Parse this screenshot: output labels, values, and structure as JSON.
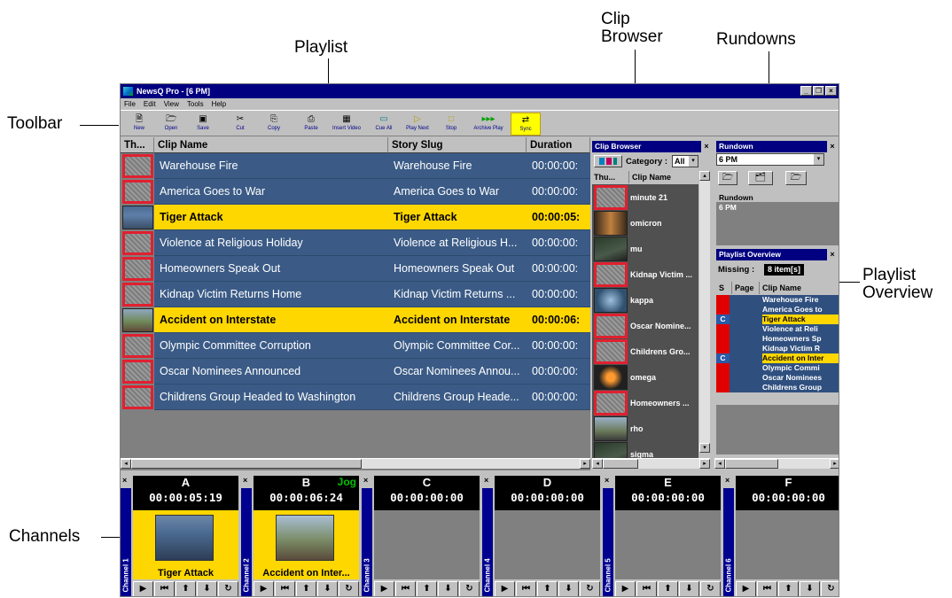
{
  "annotations": {
    "playlist": "Playlist",
    "clip_browser_l1": "Clip",
    "clip_browser_l2": "Browser",
    "rundowns": "Rundowns",
    "toolbar": "Toolbar",
    "playlist_overview_l1": "Playlist",
    "playlist_overview_l2": "Overview",
    "channels": "Channels"
  },
  "window": {
    "title": "NewsQ Pro - [6 PM]",
    "minimize": "_",
    "restore": "❐",
    "close": "×"
  },
  "menu": [
    "File",
    "Edit",
    "View",
    "Tools",
    "Help"
  ],
  "toolbar": [
    {
      "label": "New",
      "icon": "new-icon",
      "glyph": "🗎"
    },
    {
      "label": "Open",
      "icon": "open-icon",
      "glyph": "🗁"
    },
    {
      "label": "Save",
      "icon": "save-icon",
      "glyph": "▣"
    },
    {
      "label": "Cut",
      "icon": "cut-icon",
      "glyph": "✂"
    },
    {
      "label": "Copy",
      "icon": "copy-icon",
      "glyph": "⎘"
    },
    {
      "label": "Paste",
      "icon": "paste-icon",
      "glyph": "⎙"
    },
    {
      "label": "Insert Video",
      "icon": "insert-video-icon",
      "glyph": "▦"
    },
    {
      "label": "Cue All",
      "icon": "cue-all-icon",
      "glyph": "▭"
    },
    {
      "label": "Play Next",
      "icon": "play-next-icon",
      "glyph": "▷"
    },
    {
      "label": "Stop",
      "icon": "stop-icon",
      "glyph": "□"
    },
    {
      "label": "Archive Play",
      "icon": "archive-play-icon",
      "glyph": "▸▸▸"
    },
    {
      "label": "Sync",
      "icon": "sync-icon",
      "glyph": "⇄"
    }
  ],
  "playlist": {
    "columns": [
      "Th...",
      "Clip Name",
      "Story Slug",
      "Duration"
    ],
    "rows": [
      {
        "clip": "Warehouse Fire",
        "slug": "Warehouse Fire",
        "duration": "00:00:00:",
        "thumb": "gray",
        "selected": false
      },
      {
        "clip": "America Goes to War",
        "slug": "America Goes to War",
        "duration": "00:00:00:",
        "thumb": "gray",
        "selected": false
      },
      {
        "clip": "Tiger Attack",
        "slug": "Tiger Attack",
        "duration": "00:00:05:",
        "thumb": "photo1",
        "selected": true
      },
      {
        "clip": "Violence at Religious Holiday",
        "slug": "Violence at Religious H...",
        "duration": "00:00:00:",
        "thumb": "gray",
        "selected": false
      },
      {
        "clip": "Homeowners Speak Out",
        "slug": "Homeowners Speak Out",
        "duration": "00:00:00:",
        "thumb": "gray",
        "selected": false
      },
      {
        "clip": "Kidnap Victim Returns Home",
        "slug": "Kidnap Victim Returns ...",
        "duration": "00:00:00:",
        "thumb": "gray",
        "selected": false
      },
      {
        "clip": "Accident on Interstate",
        "slug": "Accident on Interstate",
        "duration": "00:00:06:",
        "thumb": "photo2",
        "selected": true
      },
      {
        "clip": "Olympic Committee Corruption",
        "slug": "Olympic Committee Cor...",
        "duration": "00:00:00:",
        "thumb": "gray",
        "selected": false
      },
      {
        "clip": "Oscar Nominees Announced",
        "slug": "Oscar Nominees Annou...",
        "duration": "00:00:00:",
        "thumb": "gray",
        "selected": false
      },
      {
        "clip": "Childrens Group Headed to Washington",
        "slug": "Childrens Group Heade...",
        "duration": "00:00:00:",
        "thumb": "gray",
        "selected": false
      }
    ]
  },
  "clip_browser": {
    "title": "Clip Browser",
    "category_label": "Category :",
    "category_value": "All",
    "columns": [
      "Thu...",
      "Clip Name"
    ],
    "items": [
      {
        "name": "minute 21",
        "thumb": "gray"
      },
      {
        "name": "omicron",
        "thumb": "ph-a"
      },
      {
        "name": "mu",
        "thumb": "ph-b"
      },
      {
        "name": "Kidnap Victim ...",
        "thumb": "gray"
      },
      {
        "name": "kappa",
        "thumb": "ph-c"
      },
      {
        "name": "Oscar Nomine...",
        "thumb": "gray"
      },
      {
        "name": "Childrens Gro...",
        "thumb": "gray"
      },
      {
        "name": "omega",
        "thumb": "ph-d"
      },
      {
        "name": "Homeowners ...",
        "thumb": "gray"
      },
      {
        "name": "rho",
        "thumb": "ph-e"
      },
      {
        "name": "sigma",
        "thumb": "ph-b"
      }
    ]
  },
  "rundown": {
    "title": "Rundown",
    "select_value": "6 PM",
    "column": "Rundown",
    "items": [
      "6 PM"
    ]
  },
  "overview": {
    "title": "Playlist Overview",
    "missing_label": "Missing :",
    "missing_value": "8 item[s]",
    "columns": [
      "S",
      "Page",
      "Clip Name"
    ],
    "rows": [
      {
        "s": "",
        "name": "Warehouse Fire",
        "sel": false
      },
      {
        "s": "",
        "name": "America Goes to",
        "sel": false
      },
      {
        "s": "C",
        "name": "Tiger Attack",
        "sel": true
      },
      {
        "s": "",
        "name": "Violence at Reli",
        "sel": false
      },
      {
        "s": "",
        "name": "Homeowners Sp",
        "sel": false
      },
      {
        "s": "",
        "name": "Kidnap Victim R",
        "sel": false
      },
      {
        "s": "C",
        "name": "Accident on Inter",
        "sel": true
      },
      {
        "s": "",
        "name": "Olympic Commi",
        "sel": false
      },
      {
        "s": "",
        "name": "Oscar Nominees",
        "sel": false
      },
      {
        "s": "",
        "name": "Childrens Group",
        "sel": false
      }
    ]
  },
  "channels": [
    {
      "letter": "A",
      "timecode": "00:00:05:19",
      "label": "Channel 1",
      "clip": "Tiger Attack",
      "live": true,
      "jog": ""
    },
    {
      "letter": "B",
      "timecode": "00:00:06:24",
      "label": "Channel 2",
      "clip": "Accident on Inter...",
      "live": true,
      "jog": "Jog"
    },
    {
      "letter": "C",
      "timecode": "00:00:00:00",
      "label": "Channel 3",
      "clip": "",
      "live": false,
      "jog": ""
    },
    {
      "letter": "D",
      "timecode": "00:00:00:00",
      "label": "Channel 4",
      "clip": "",
      "live": false,
      "jog": ""
    },
    {
      "letter": "E",
      "timecode": "00:00:00:00",
      "label": "Channel 5",
      "clip": "",
      "live": false,
      "jog": ""
    },
    {
      "letter": "F",
      "timecode": "00:00:00:00",
      "label": "Channel 6",
      "clip": "",
      "live": false,
      "jog": ""
    }
  ],
  "channel_controls": [
    {
      "glyph": "▶",
      "icon": "play-icon"
    },
    {
      "glyph": "⏮",
      "icon": "rewind-start-icon"
    },
    {
      "glyph": "⬆",
      "icon": "previous-icon"
    },
    {
      "glyph": "⬇",
      "icon": "next-icon"
    },
    {
      "glyph": "↻",
      "icon": "loop-icon"
    }
  ],
  "colors": {
    "row_blue": "#3b5b86",
    "row_selected": "#ffd700",
    "title_bar": "#000080",
    "thumb_border": "#e02030"
  }
}
